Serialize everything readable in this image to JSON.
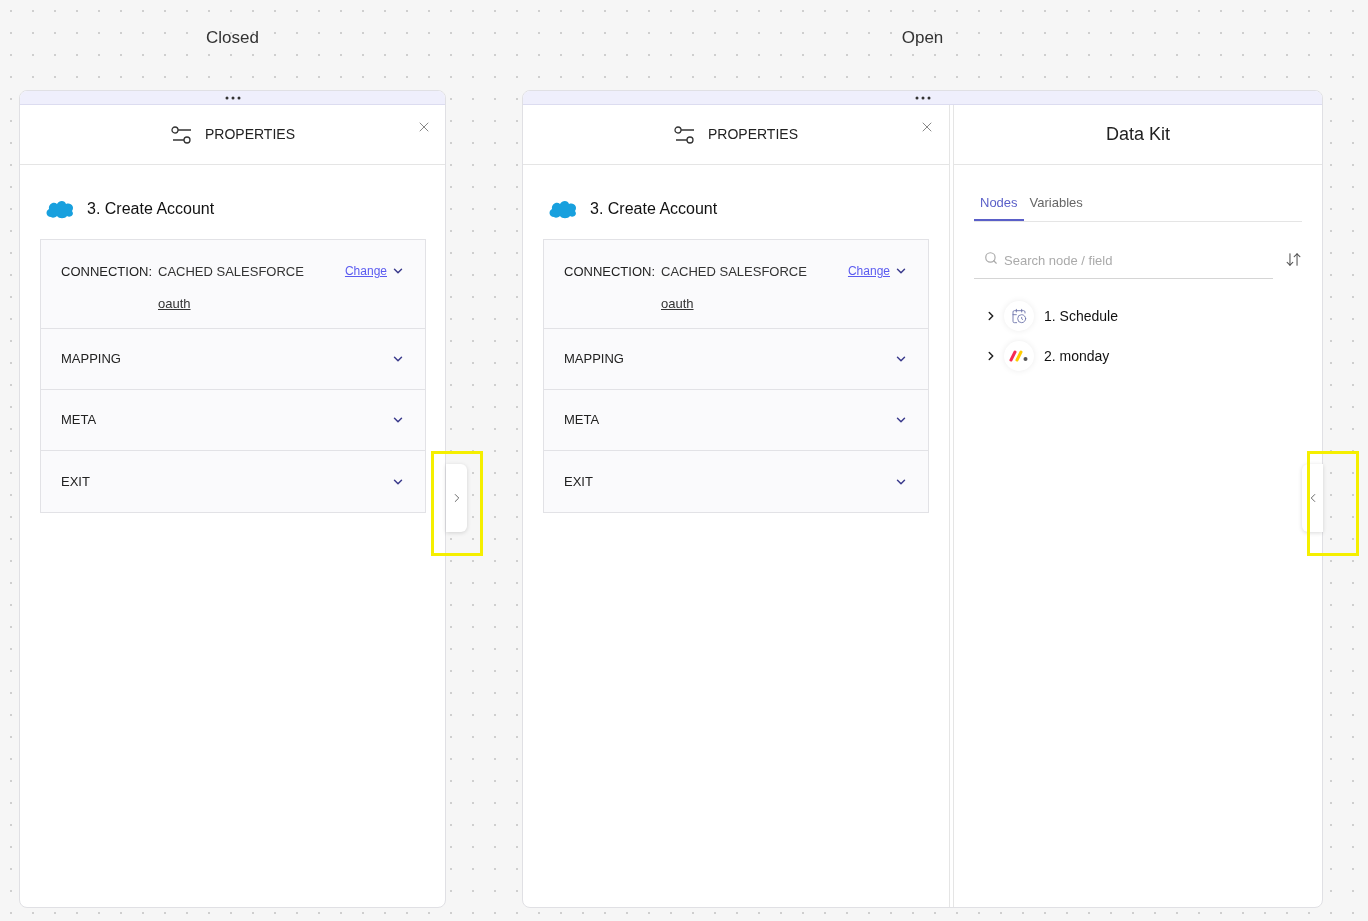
{
  "panels": [
    {
      "caption": "Closed",
      "expanded": false,
      "properties": {
        "title": "PROPERTIES",
        "step": "3. Create Account",
        "connection": {
          "label": "CONNECTION:",
          "value": "CACHED SALESFORCE",
          "action": "Change",
          "account": "oauth"
        },
        "sections": [
          {
            "title": "MAPPING"
          },
          {
            "title": "META"
          },
          {
            "title": "EXIT"
          }
        ]
      }
    },
    {
      "caption": "Open",
      "expanded": true,
      "properties": {
        "title": "PROPERTIES",
        "step": "3. Create Account",
        "connection": {
          "label": "CONNECTION:",
          "value": "CACHED SALESFORCE",
          "action": "Change",
          "account": "oauth"
        },
        "sections": [
          {
            "title": "MAPPING"
          },
          {
            "title": "META"
          },
          {
            "title": "EXIT"
          }
        ]
      },
      "data_kit": {
        "title": "Data Kit",
        "tabs": [
          {
            "label": "Nodes",
            "selected": true
          },
          {
            "label": "Variables",
            "selected": false
          }
        ],
        "search": {
          "placeholder": "Search node / field"
        },
        "nodes": [
          {
            "label": "1. Schedule",
            "kind": "schedule"
          },
          {
            "label": "2. monday",
            "kind": "monday"
          }
        ]
      }
    }
  ]
}
